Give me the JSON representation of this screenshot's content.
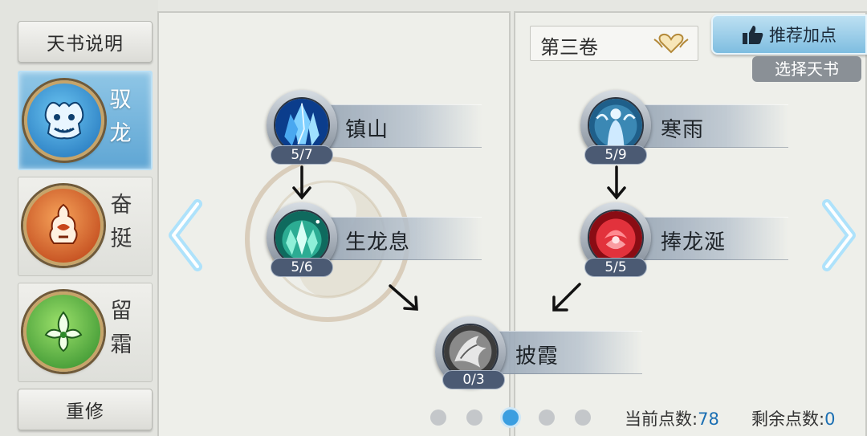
{
  "sidebar": {
    "info_button": "天书说明",
    "reset_button": "重修",
    "books": [
      {
        "label": "驭龙",
        "icon": "dragon-head-icon",
        "active": true
      },
      {
        "label": "奋挺",
        "icon": "flame-gourd-icon",
        "active": false
      },
      {
        "label": "留霜",
        "icon": "frost-flower-icon",
        "active": false
      }
    ]
  },
  "volume": {
    "label": "第三卷",
    "icon": "heart-wings-icon"
  },
  "recommend_button": {
    "label": "推荐加点",
    "icon": "thumbs-up-icon"
  },
  "choose_book_button": "选择天书",
  "skills": {
    "zhenshan": {
      "name": "镇山",
      "count": "5/7",
      "icon": "ice-crystal-icon"
    },
    "shenglongxi": {
      "name": "生龙息",
      "count": "5/6",
      "icon": "jade-crystal-icon"
    },
    "hanyu": {
      "name": "寒雨",
      "count": "5/9",
      "icon": "spirit-figure-icon"
    },
    "penglongxian": {
      "name": "捧龙涎",
      "count": "5/5",
      "icon": "red-rose-icon"
    },
    "pixia": {
      "name": "披霞",
      "count": "0/3",
      "icon": "silver-wing-icon"
    }
  },
  "pagination": {
    "total": 5,
    "active_index": 2
  },
  "points": {
    "current_label": "当前点数:",
    "current_value": "78",
    "remaining_label": "剩余点数:",
    "remaining_value": "0"
  },
  "colors": {
    "active_tab": "#6fb3dd",
    "count_badge": "#4b5a73",
    "points_value": "#1b6fb3",
    "active_dot": "#3b9ee0"
  }
}
